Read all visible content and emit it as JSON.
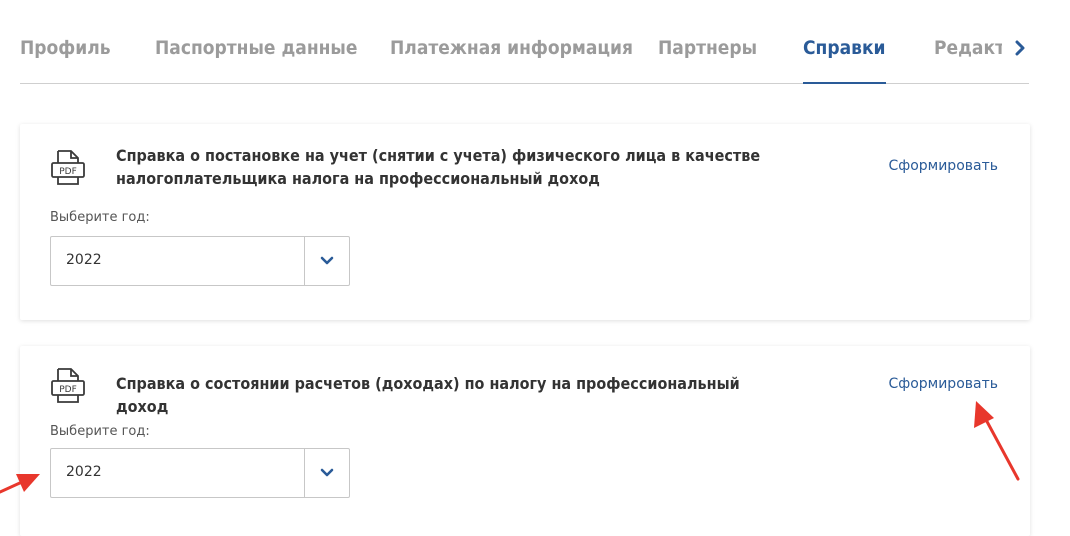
{
  "tabs": {
    "items": [
      {
        "label": "Профиль"
      },
      {
        "label": "Паспортные данные"
      },
      {
        "label": "Платежная информация"
      },
      {
        "label": "Партнеры"
      },
      {
        "label": "Справки"
      },
      {
        "label": "Редактор"
      }
    ],
    "active_index": 4,
    "next_icon": "chevron-right-icon"
  },
  "cards": [
    {
      "icon": "pdf-document-icon",
      "icon_text": "PDF",
      "title_line1": "Справка о постановке на учет (снятии с учета) физического лица в качестве",
      "title_line2": "налогоплательщика налога на профессиональный доход",
      "action": "Сформировать",
      "year_label": "Выберите год:",
      "year_value": "2022"
    },
    {
      "icon": "pdf-document-icon",
      "icon_text": "PDF",
      "title_line1": "Справка о состоянии расчетов (доходах) по налогу на профессиональный доход",
      "action": "Сформировать",
      "year_label": "Выберите год:",
      "year_value": "2022"
    }
  ],
  "colors": {
    "accent": "#2a5b98",
    "inactive_tab": "#9b9b9b",
    "annotation_arrow": "#e8372c"
  }
}
